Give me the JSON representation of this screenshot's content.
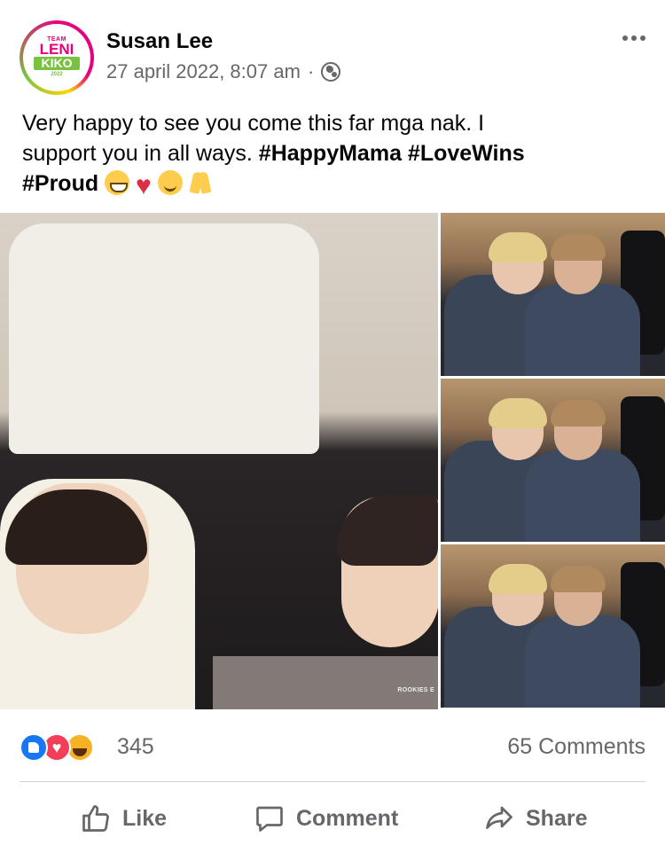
{
  "post": {
    "avatar": {
      "team": "TEAM",
      "line1": "LENI",
      "line2": "KIKO",
      "year": "2022"
    },
    "author": "Susan Lee",
    "timestamp": "27 april 2022, 8:07 am",
    "separator": "·",
    "privacy_icon": "globe-icon",
    "more_icon": "more-options-icon",
    "text": {
      "line1": "Very happy to see you come this far mga nak. I",
      "line2_plain": "support you in all ways. ",
      "hashtag1": "#HappyMama",
      "hashtag2": "#LoveWins",
      "hashtag3": "#Proud",
      "emojis": [
        "grinning-face",
        "red-heart",
        "smiling-face",
        "folded-hands"
      ]
    },
    "photos": {
      "main_watermark": "ROOKIES E",
      "thumbnail_count": 3
    }
  },
  "stats": {
    "reactions": [
      "like",
      "love",
      "haha"
    ],
    "reaction_count": "345",
    "comment_count": "65 Comments"
  },
  "actions": {
    "like": "Like",
    "comment": "Comment",
    "share": "Share"
  },
  "colors": {
    "text": "#050505",
    "secondary": "#65676b",
    "like_blue": "#1877f2",
    "love_red": "#f33e58",
    "haha_yellow": "#f7b125",
    "divider": "#ced0d4"
  }
}
